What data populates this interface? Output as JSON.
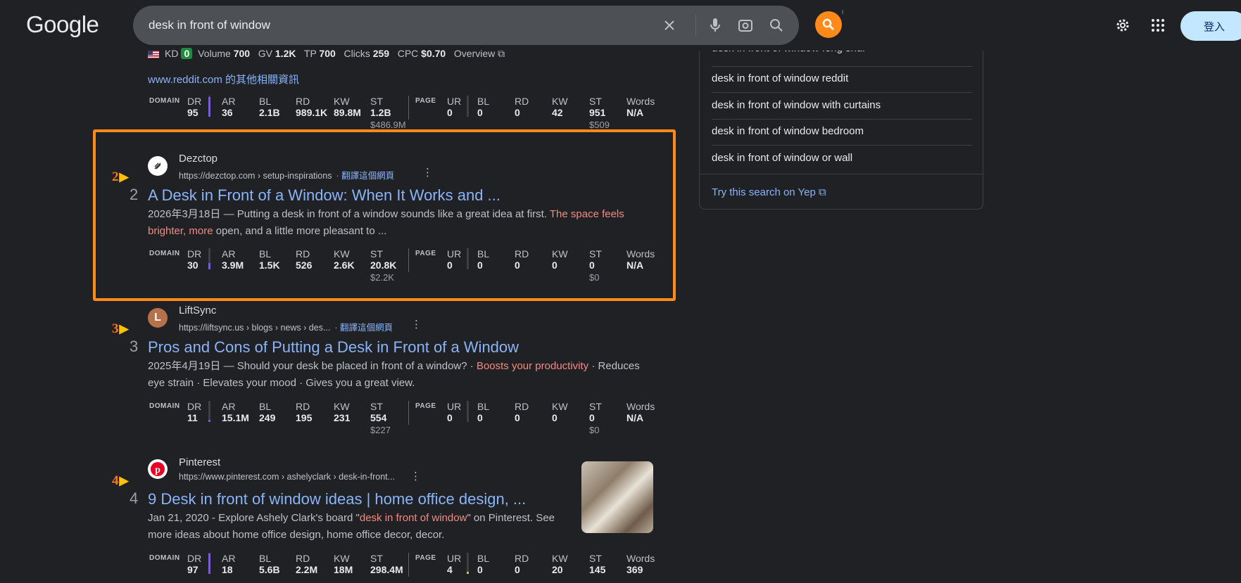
{
  "header": {
    "logo": "Google",
    "search_value": "desk in front of window",
    "clear_icon": "close-icon",
    "voice_icon": "mic-icon",
    "lens_icon": "camera-lens-icon",
    "search_icon": "search-icon",
    "extension_info": "i",
    "signin_label": "登入"
  },
  "top_result": {
    "kd_label": "KD",
    "kd_value": "0",
    "volume_label": "Volume",
    "volume_value": "700",
    "gv_label": "GV",
    "gv_value": "1.2K",
    "tp_label": "TP",
    "tp_value": "700",
    "clicks_label": "Clicks",
    "clicks_value": "259",
    "cpc_label": "CPC",
    "cpc_value": "$0.70",
    "overview_label": "Overview",
    "more_link": "www.reddit.com 的其他相關資訊",
    "metrics": {
      "domain_label": "DOMAIN",
      "page_label": "PAGE",
      "dr": "95",
      "ar": "36",
      "bl": "2.1B",
      "rd": "989.1K",
      "kw": "89.8M",
      "st": "1.2B",
      "st_sub": "$486.9M",
      "ur": "0",
      "pbl": "0",
      "prd": "0",
      "pkw": "42",
      "pst": "951",
      "pst_sub": "$509",
      "words": "N/A",
      "dr_fill": 0.95,
      "ur_fill": 0.0
    }
  },
  "metric_labels": {
    "dr": "DR",
    "ar": "AR",
    "bl": "BL",
    "rd": "RD",
    "kw": "KW",
    "st": "ST",
    "ur": "UR",
    "words": "Words"
  },
  "results": [
    {
      "rank_marker": "2",
      "rank": "2",
      "site": "Dezctop",
      "url": "https://dezctop.com › setup-inspirations",
      "translate": "· 翻譯這個網頁",
      "title": "A Desk in Front of a Window: When It Works and ...",
      "snippet_date": "2026年3月18日 — Putting a desk in front of a window sounds like a great idea at first. ",
      "snippet_hl": "The space feels brighter, more",
      "snippet_rest": " open, and a little more pleasant to ...",
      "metrics": {
        "dr": "30",
        "ar": "3.9M",
        "bl": "1.5K",
        "rd": "526",
        "kw": "2.6K",
        "st": "20.8K",
        "st_sub": "$2.2K",
        "ur": "0",
        "pbl": "0",
        "prd": "0",
        "pkw": "0",
        "pst": "0",
        "pst_sub": "$0",
        "words": "N/A",
        "dr_fill": 0.3,
        "ur_fill": 0.0
      }
    },
    {
      "rank_marker": "3",
      "rank": "3",
      "site": "LiftSync",
      "url": "https://liftsync.us › blogs › news › des...",
      "translate": "· 翻譯這個網頁",
      "title": "Pros and Cons of Putting a Desk in Front of a Window",
      "snippet_a": "2025年4月19日 — Should your desk be placed in front of a window? · ",
      "snippet_hl": "Boosts your productivity",
      "snippet_b": " · Reduces eye strain · Elevates your mood · Gives you a great view.",
      "metrics": {
        "dr": "11",
        "ar": "15.1M",
        "bl": "249",
        "rd": "195",
        "kw": "231",
        "st": "554",
        "st_sub": "$227",
        "ur": "0",
        "pbl": "0",
        "prd": "0",
        "pkw": "0",
        "pst": "0",
        "pst_sub": "$0",
        "words": "N/A",
        "dr_fill": 0.11,
        "ur_fill": 0.0
      }
    },
    {
      "rank_marker": "4",
      "rank": "4",
      "site": "Pinterest",
      "url": "https://www.pinterest.com › ashelyclark › desk-in-front...",
      "title": "9 Desk in front of window ideas | home office design, ...",
      "snippet_a": "Jan 21, 2020 - Explore Ashely Clark's board \"",
      "snippet_hl": "desk in front of window",
      "snippet_b": "\" on Pinterest. See more ideas about home office design, home office decor, decor.",
      "metrics": {
        "dr": "97",
        "ar": "18",
        "bl": "5.6B",
        "rd": "2.2M",
        "kw": "18M",
        "st": "298.4M",
        "ur": "4",
        "pbl": "0",
        "prd": "0",
        "pkw": "20",
        "pst": "145",
        "words": "369",
        "dr_fill": 0.97,
        "ur_fill": 0.04
      }
    }
  ],
  "sidebar": {
    "partial_item": "desk in front of window feng shui",
    "items": [
      "desk in front of window reddit",
      "desk in front of window with curtains",
      "desk in front of window bedroom",
      "desk in front of window or wall"
    ],
    "yep_link": "Try this search on Yep"
  }
}
